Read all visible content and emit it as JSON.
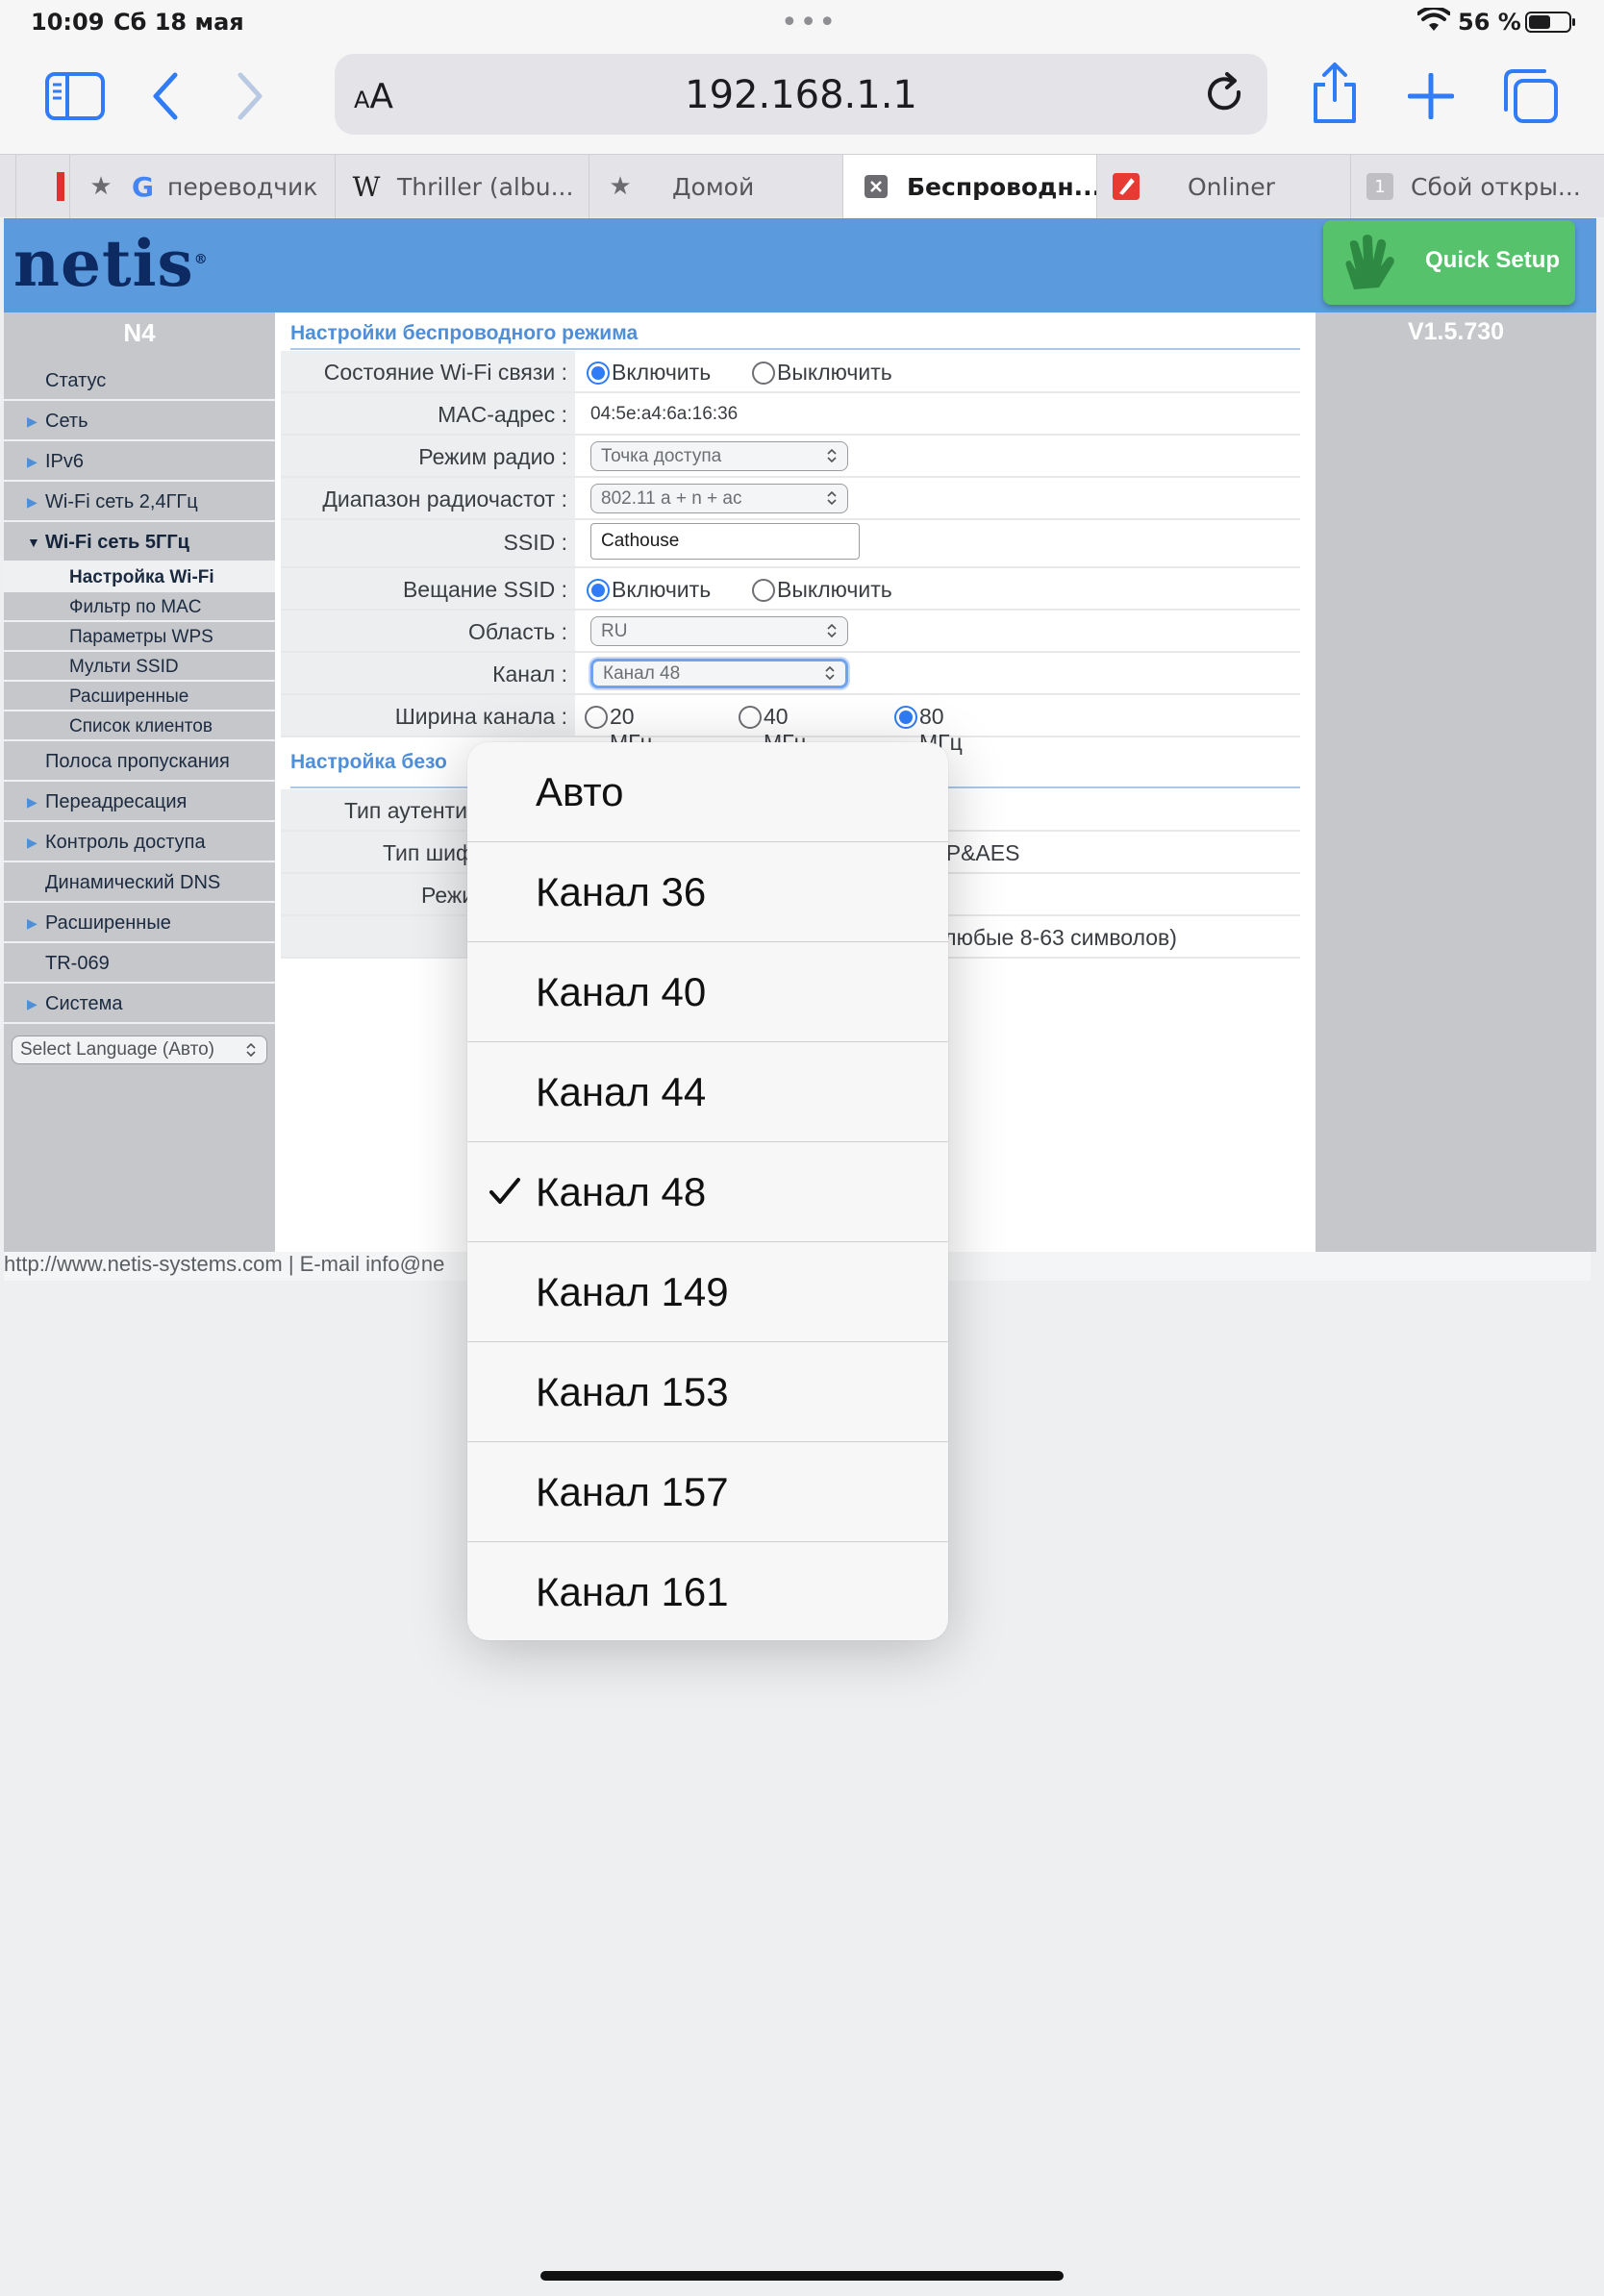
{
  "status_bar": {
    "time": "10:09",
    "date": "Сб 18 мая",
    "battery_pct": "56 %",
    "battery_level": 0.56
  },
  "browser": {
    "aa": "AA",
    "url": "192.168.1.1",
    "tabs": [
      {
        "label": "",
        "icon": "red-edge"
      },
      {
        "label": "переводчик",
        "icon": "star-icon"
      },
      {
        "label": "Thriller (albu...",
        "icon": "wikipedia-icon"
      },
      {
        "label": "Домой",
        "icon": "star-icon"
      },
      {
        "label": "Беспроводн...",
        "icon": "close-icon",
        "active": true
      },
      {
        "label": "Onliner",
        "icon": "onliner-icon"
      },
      {
        "label": "Сбой откры...",
        "icon": "number-icon",
        "badge": "1"
      }
    ]
  },
  "router": {
    "brand": "netis",
    "quick_setup": "Quick Setup",
    "model": "N4",
    "version": "V1.5.730",
    "nav": [
      {
        "label": "Статус",
        "arrow": false
      },
      {
        "label": "Сеть",
        "arrow": true
      },
      {
        "label": "IPv6",
        "arrow": true
      },
      {
        "label": "Wi-Fi сеть 2,4ГГц",
        "arrow": true
      },
      {
        "label": "Wi-Fi сеть 5ГГц",
        "arrow": true,
        "open": true
      }
    ],
    "subnav": [
      "Настройка Wi-Fi",
      "Фильтр по MAC",
      "Параметры WPS",
      "Мульти SSID",
      "Расширенные",
      "Список клиентов"
    ],
    "nav_after": [
      {
        "label": "Полоса пропускания",
        "arrow": false
      },
      {
        "label": "Переадресация",
        "arrow": true
      },
      {
        "label": "Контроль доступа",
        "arrow": true
      },
      {
        "label": "Динамический DNS",
        "arrow": false
      },
      {
        "label": "Расширенные",
        "arrow": true
      },
      {
        "label": "TR-069",
        "arrow": false
      },
      {
        "label": "Система",
        "arrow": true
      }
    ],
    "language_select": "Select Language (Авто)",
    "wireless_title": "Настройки беспроводного режима",
    "fields": {
      "wifi_state": {
        "label": "Состояние Wi-Fi связи :",
        "on": "Включить",
        "off": "Выключить"
      },
      "mac": {
        "label": "MAC-адрес :",
        "value": "04:5e:a4:6a:16:36"
      },
      "radio_mode": {
        "label": "Режим радио :",
        "value": "Точка доступа"
      },
      "band": {
        "label": "Диапазон радиочастот :",
        "value": "802.11 a + n + ac"
      },
      "ssid": {
        "label": "SSID :",
        "value": "Cathouse"
      },
      "broadcast": {
        "label": "Вещание SSID :",
        "on": "Включить",
        "off": "Выключить"
      },
      "region": {
        "label": "Область :",
        "value": "RU"
      },
      "channel": {
        "label": "Канал :",
        "value": "Канал 48"
      },
      "width": {
        "label": "Ширина канала :",
        "opt20": "20 МГц",
        "opt40": "40 МГц",
        "opt80": "80 МГц"
      }
    },
    "security_title_partial": "Настройка безо",
    "security_rows": {
      "auth_partial": "Тип аутенти",
      "cipher_partial": "Тип шиф",
      "cipher_value_partial": "KIP&AES",
      "mode_partial": "Режи",
      "hint_partial": "е любые 8-63 символов)"
    },
    "footer": "http://www.netis-systems.com | E-mail info@ne"
  },
  "picker": {
    "options": [
      "Авто",
      "Канал 36",
      "Канал 40",
      "Канал 44",
      "Канал 48",
      "Канал 149",
      "Канал 153",
      "Канал 157",
      "Канал 161"
    ],
    "selected_index": 4
  }
}
